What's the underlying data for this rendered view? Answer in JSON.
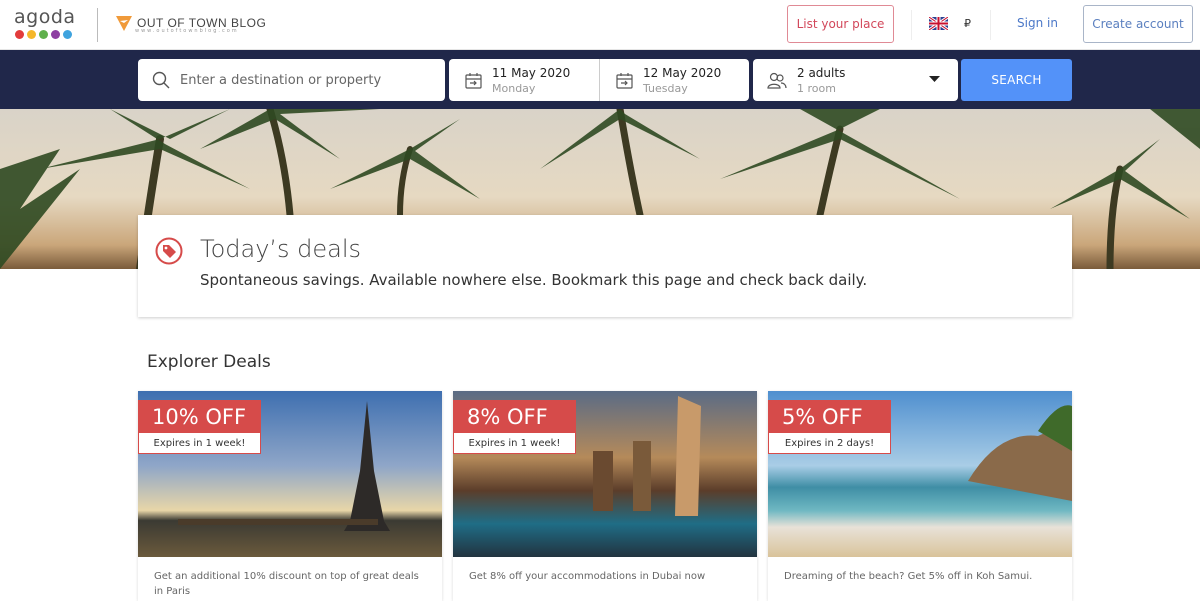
{
  "header": {
    "logo": "agoda",
    "logo_dot_colors": [
      "#e23c3c",
      "#f5b72a",
      "#5fb04c",
      "#8e3fa2",
      "#3fa3de"
    ],
    "partner_logo": "OUT OF TOWN BLOG",
    "partner_url": "www.outoftownblog.com",
    "list_place": "List your place",
    "currency": "₽",
    "sign_in": "Sign in",
    "create_account": "Create account"
  },
  "search": {
    "placeholder": "Enter a destination or property",
    "checkin_date": "11 May 2020",
    "checkin_day": "Monday",
    "checkout_date": "12 May 2020",
    "checkout_day": "Tuesday",
    "guests": "2 adults",
    "rooms": "1 room",
    "button": "SEARCH"
  },
  "deals": {
    "title": "Today’s deals",
    "subtitle": "Spontaneous savings. Available nowhere else. Bookmark this page and check back daily.",
    "accent": "#d64b4a"
  },
  "explorer": {
    "heading": "Explorer Deals",
    "cards": [
      {
        "discount": "10% OFF",
        "expires": "Expires in 1 week!",
        "description": "Get an additional 10% discount on top of great deals in Paris"
      },
      {
        "discount": "8% OFF",
        "expires": "Expires in 1 week!",
        "description": "Get 8% off your accommodations in Dubai now"
      },
      {
        "discount": "5% OFF",
        "expires": "Expires in 2 days!",
        "description": "Dreaming of the beach? Get 5% off in Koh Samui."
      }
    ]
  }
}
